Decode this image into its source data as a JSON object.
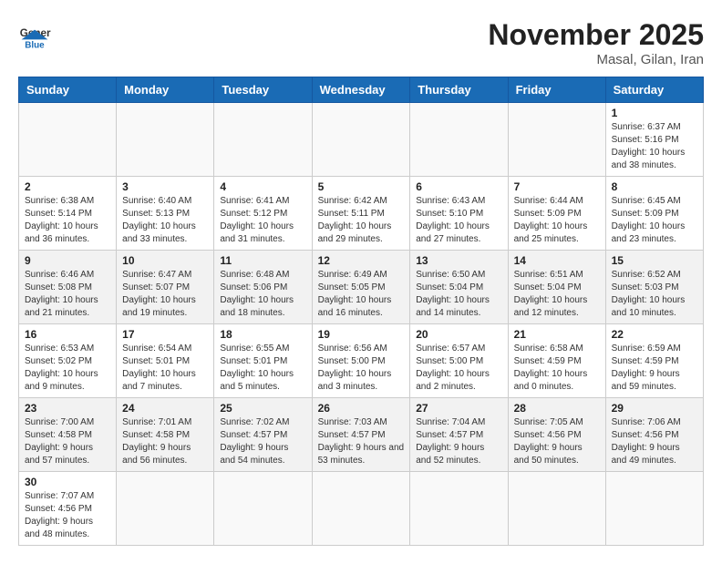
{
  "header": {
    "logo_general": "General",
    "logo_blue": "Blue",
    "month_title": "November 2025",
    "location": "Masal, Gilan, Iran"
  },
  "days_of_week": [
    "Sunday",
    "Monday",
    "Tuesday",
    "Wednesday",
    "Thursday",
    "Friday",
    "Saturday"
  ],
  "weeks": [
    {
      "shade": false,
      "days": [
        {
          "num": "",
          "info": ""
        },
        {
          "num": "",
          "info": ""
        },
        {
          "num": "",
          "info": ""
        },
        {
          "num": "",
          "info": ""
        },
        {
          "num": "",
          "info": ""
        },
        {
          "num": "",
          "info": ""
        },
        {
          "num": "1",
          "info": "Sunrise: 6:37 AM\nSunset: 5:16 PM\nDaylight: 10 hours and 38 minutes."
        }
      ]
    },
    {
      "shade": false,
      "days": [
        {
          "num": "2",
          "info": "Sunrise: 6:38 AM\nSunset: 5:14 PM\nDaylight: 10 hours and 36 minutes."
        },
        {
          "num": "3",
          "info": "Sunrise: 6:40 AM\nSunset: 5:13 PM\nDaylight: 10 hours and 33 minutes."
        },
        {
          "num": "4",
          "info": "Sunrise: 6:41 AM\nSunset: 5:12 PM\nDaylight: 10 hours and 31 minutes."
        },
        {
          "num": "5",
          "info": "Sunrise: 6:42 AM\nSunset: 5:11 PM\nDaylight: 10 hours and 29 minutes."
        },
        {
          "num": "6",
          "info": "Sunrise: 6:43 AM\nSunset: 5:10 PM\nDaylight: 10 hours and 27 minutes."
        },
        {
          "num": "7",
          "info": "Sunrise: 6:44 AM\nSunset: 5:09 PM\nDaylight: 10 hours and 25 minutes."
        },
        {
          "num": "8",
          "info": "Sunrise: 6:45 AM\nSunset: 5:09 PM\nDaylight: 10 hours and 23 minutes."
        }
      ]
    },
    {
      "shade": true,
      "days": [
        {
          "num": "9",
          "info": "Sunrise: 6:46 AM\nSunset: 5:08 PM\nDaylight: 10 hours and 21 minutes."
        },
        {
          "num": "10",
          "info": "Sunrise: 6:47 AM\nSunset: 5:07 PM\nDaylight: 10 hours and 19 minutes."
        },
        {
          "num": "11",
          "info": "Sunrise: 6:48 AM\nSunset: 5:06 PM\nDaylight: 10 hours and 18 minutes."
        },
        {
          "num": "12",
          "info": "Sunrise: 6:49 AM\nSunset: 5:05 PM\nDaylight: 10 hours and 16 minutes."
        },
        {
          "num": "13",
          "info": "Sunrise: 6:50 AM\nSunset: 5:04 PM\nDaylight: 10 hours and 14 minutes."
        },
        {
          "num": "14",
          "info": "Sunrise: 6:51 AM\nSunset: 5:04 PM\nDaylight: 10 hours and 12 minutes."
        },
        {
          "num": "15",
          "info": "Sunrise: 6:52 AM\nSunset: 5:03 PM\nDaylight: 10 hours and 10 minutes."
        }
      ]
    },
    {
      "shade": false,
      "days": [
        {
          "num": "16",
          "info": "Sunrise: 6:53 AM\nSunset: 5:02 PM\nDaylight: 10 hours and 9 minutes."
        },
        {
          "num": "17",
          "info": "Sunrise: 6:54 AM\nSunset: 5:01 PM\nDaylight: 10 hours and 7 minutes."
        },
        {
          "num": "18",
          "info": "Sunrise: 6:55 AM\nSunset: 5:01 PM\nDaylight: 10 hours and 5 minutes."
        },
        {
          "num": "19",
          "info": "Sunrise: 6:56 AM\nSunset: 5:00 PM\nDaylight: 10 hours and 3 minutes."
        },
        {
          "num": "20",
          "info": "Sunrise: 6:57 AM\nSunset: 5:00 PM\nDaylight: 10 hours and 2 minutes."
        },
        {
          "num": "21",
          "info": "Sunrise: 6:58 AM\nSunset: 4:59 PM\nDaylight: 10 hours and 0 minutes."
        },
        {
          "num": "22",
          "info": "Sunrise: 6:59 AM\nSunset: 4:59 PM\nDaylight: 9 hours and 59 minutes."
        }
      ]
    },
    {
      "shade": true,
      "days": [
        {
          "num": "23",
          "info": "Sunrise: 7:00 AM\nSunset: 4:58 PM\nDaylight: 9 hours and 57 minutes."
        },
        {
          "num": "24",
          "info": "Sunrise: 7:01 AM\nSunset: 4:58 PM\nDaylight: 9 hours and 56 minutes."
        },
        {
          "num": "25",
          "info": "Sunrise: 7:02 AM\nSunset: 4:57 PM\nDaylight: 9 hours and 54 minutes."
        },
        {
          "num": "26",
          "info": "Sunrise: 7:03 AM\nSunset: 4:57 PM\nDaylight: 9 hours and 53 minutes."
        },
        {
          "num": "27",
          "info": "Sunrise: 7:04 AM\nSunset: 4:57 PM\nDaylight: 9 hours and 52 minutes."
        },
        {
          "num": "28",
          "info": "Sunrise: 7:05 AM\nSunset: 4:56 PM\nDaylight: 9 hours and 50 minutes."
        },
        {
          "num": "29",
          "info": "Sunrise: 7:06 AM\nSunset: 4:56 PM\nDaylight: 9 hours and 49 minutes."
        }
      ]
    },
    {
      "shade": false,
      "days": [
        {
          "num": "30",
          "info": "Sunrise: 7:07 AM\nSunset: 4:56 PM\nDaylight: 9 hours and 48 minutes."
        },
        {
          "num": "",
          "info": ""
        },
        {
          "num": "",
          "info": ""
        },
        {
          "num": "",
          "info": ""
        },
        {
          "num": "",
          "info": ""
        },
        {
          "num": "",
          "info": ""
        },
        {
          "num": "",
          "info": ""
        }
      ]
    }
  ]
}
